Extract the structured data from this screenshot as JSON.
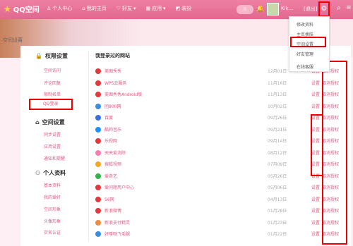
{
  "topbar": {
    "logo": "QQ空间",
    "nav": [
      "个人中心",
      "我的主页",
      "好友",
      "应用",
      "装扮"
    ],
    "nav_icons": [
      "person-icon",
      "home-icon",
      "friends-icon",
      "apps-icon",
      "shirt-icon"
    ],
    "pill": "II",
    "username": "Kik...",
    "logout": "[退出]"
  },
  "page_title": "空间设置",
  "dropdown": [
    "修改资料",
    "主页换肤",
    "空间设置",
    "好友管理",
    "在线客服"
  ],
  "sidebar": {
    "sections": [
      {
        "title": "权限设置",
        "items": [
          "空间访问",
          "评论回复",
          "限制名单",
          "QQ登录"
        ]
      },
      {
        "title": "空间设置",
        "items": [
          "同步设置",
          "应用设置",
          "通知和提醒"
        ]
      },
      {
        "title": "个人资料",
        "items": [
          "基本资料",
          "我的爱好",
          "空间形象",
          "头像形象",
          "实名认证"
        ]
      }
    ]
  },
  "main": {
    "heading": "我登录过的网站",
    "rows": [
      {
        "name": "美图秀秀",
        "date": "12月01日",
        "color": "#e4393c",
        "set": "设置",
        "revoke": "取消授权"
      },
      {
        "name": "WPS云服务",
        "date": "11月16日",
        "color": "#e4393c",
        "set": "设置",
        "revoke": "取消授权"
      },
      {
        "name": "美图秀秀Android版",
        "date": "11月13日",
        "color": "#e4393c",
        "set": "设置",
        "revoke": "取消授权"
      },
      {
        "name": "团800网",
        "date": "10月02日",
        "color": "#3b8ede",
        "set": "设置",
        "revoke": "取消授权"
      },
      {
        "name": "百度",
        "date": "09月26日",
        "color": "#3b6fe0",
        "set": "设置",
        "revoke": "取消授权"
      },
      {
        "name": "酷狗音乐",
        "date": "09月21日",
        "color": "#1e90ff",
        "set": "设置",
        "revoke": "取消授权"
      },
      {
        "name": "乐视网",
        "date": "09月14日",
        "color": "#e4393c",
        "set": "设置",
        "revoke": "取消授权"
      },
      {
        "name": "天天爱消除",
        "date": "08月12日",
        "color": "#ff7bb0",
        "set": "设置",
        "revoke": "取消授权"
      },
      {
        "name": "搜狐视频",
        "date": "07月09日",
        "color": "#f5a623",
        "set": "设置",
        "revoke": "取消授权"
      },
      {
        "name": "爱奇艺",
        "date": "05月26日",
        "color": "#32b44a",
        "set": "设置",
        "revoke": "取消授权"
      },
      {
        "name": "爱问题用户中心",
        "date": "05月06日",
        "color": "#e4393c",
        "set": "设置",
        "revoke": "取消授权"
      },
      {
        "name": "56网",
        "date": "04月13日",
        "color": "#e4393c",
        "set": "设置",
        "revoke": "取消授权"
      },
      {
        "name": "新浪微博",
        "date": "01月28日",
        "color": "#e4393c",
        "set": "设置",
        "revoke": "取消授权"
      },
      {
        "name": "新浪支付精灵",
        "date": "01月23日",
        "color": "#f08d3c",
        "set": "设置",
        "revoke": "取消授权"
      },
      {
        "name": "好嗲呀飞毛腿",
        "date": "01月22日",
        "color": "#3b8ede",
        "set": "设置",
        "revoke": "取消授权"
      }
    ]
  }
}
